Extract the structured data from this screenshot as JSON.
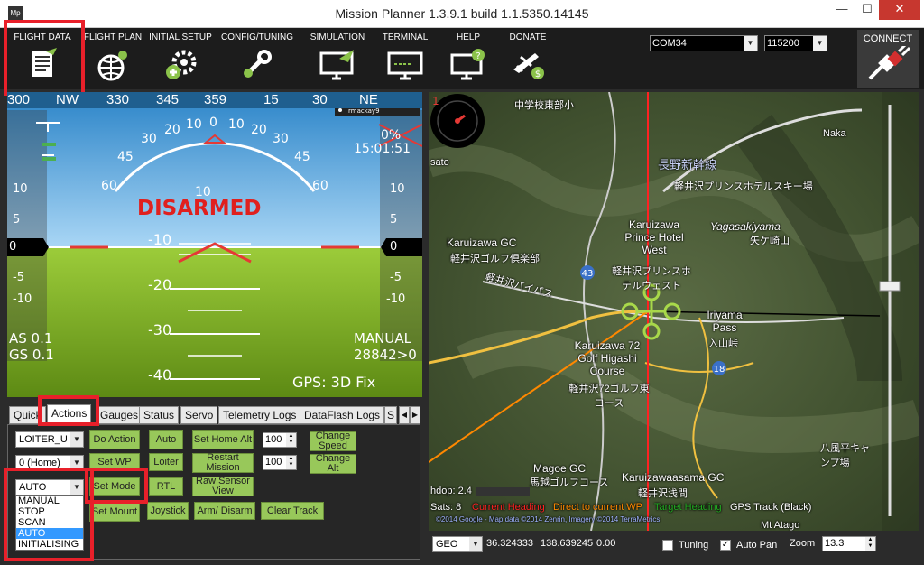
{
  "window": {
    "title": "Mission Planner 1.3.9.1 build 1.1.5350.14145",
    "icon": "Mp",
    "minimize": "—",
    "maximize": "☐",
    "close": "✕"
  },
  "toolbar": {
    "items": [
      {
        "label": "FLIGHT DATA",
        "icon": "flight-data-icon"
      },
      {
        "label": "FLIGHT PLAN",
        "icon": "flight-plan-icon"
      },
      {
        "label": "INITIAL SETUP",
        "icon": "initial-setup-icon"
      },
      {
        "label": "CONFIG/TUNING",
        "icon": "config-tuning-icon"
      },
      {
        "label": "SIMULATION",
        "icon": "simulation-icon"
      },
      {
        "label": "TERMINAL",
        "icon": "terminal-icon"
      },
      {
        "label": "HELP",
        "icon": "help-icon"
      },
      {
        "label": "DONATE",
        "icon": "donate-icon"
      }
    ],
    "port": "COM34",
    "baud": "115200",
    "connect_label": "CONNECT"
  },
  "hud": {
    "heading_ticks": [
      "300",
      "NW",
      "330",
      "345",
      "359",
      "15",
      "30",
      "NE"
    ],
    "pitch_labels": [
      "10",
      "-10",
      "-20",
      "-30",
      "-40"
    ],
    "roll_labels": [
      "60",
      "45",
      "30",
      "20",
      "10",
      "0",
      "10",
      "20",
      "30",
      "45",
      "60"
    ],
    "left_scale": [
      "10",
      "5",
      "0",
      "-5",
      "-10"
    ],
    "right_scale": [
      "10",
      "5",
      "0",
      "-5",
      "-10"
    ],
    "status": "DISARMED",
    "battery": "0%",
    "time": "15:01:51",
    "airspeed": "AS 0.1",
    "groundspeed": "GS 0.1",
    "mode": "MANUAL",
    "wp_info": "28842>0",
    "gps": "GPS: 3D Fix",
    "mini_label": "rmackay9"
  },
  "tabs": [
    "Quick",
    "Actions",
    "Gauges",
    "Status",
    "Servo",
    "Telemetry Logs",
    "DataFlash Logs",
    "S"
  ],
  "actions": {
    "mode_select": "LOITER_U",
    "wp_select": "0 (Home)",
    "setmode_select": "AUTO",
    "buttons": {
      "do_action": "Do Action",
      "auto": "Auto",
      "set_home_alt": "Set Home Alt",
      "set_wp": "Set WP",
      "loiter": "Loiter",
      "restart_mission": "Restart Mission",
      "set_mode": "Set Mode",
      "rtl": "RTL",
      "raw_sensor_view": "Raw Sensor View",
      "set_mount": "Set Mount",
      "joystick": "Joystick",
      "arm_disarm": "Arm/ Disarm",
      "clear_track": "Clear Track",
      "change_speed": "Change Speed",
      "change_alt": "Change Alt"
    },
    "speed_value": "100",
    "alt_value": "100",
    "dropdown_options": [
      "MANUAL",
      "STOP",
      "SCAN",
      "AUTO",
      "INITIALISING"
    ],
    "dropdown_selected": "AUTO"
  },
  "map": {
    "labels": {
      "nakaba": "Naka",
      "karuizawa_gc": "Karuizawa GC",
      "karuizawa_gc_jp": "軽井沢ゴルフ倶楽部",
      "prince_hotel": "Karuizawa Prince Hotel West",
      "prince_jp": "軽井沢プリンスホテルウェスト",
      "yagasaki": "Yagasakiyama",
      "yagasaki_jp": "矢ケ崎山",
      "iriyama": "Iriyama Pass",
      "iriyama_jp": "入山峠",
      "k72": "Karuizawa 72 Golf Higashi Course",
      "k72_jp": "軽井沢72ゴルフ東コース",
      "magoe": "Magoe GC",
      "magoe_jp": "馬越ゴルフコース",
      "waasama": "Karuizawaasama GC",
      "waasama_jp": "軽井沢浅間",
      "prince_ski": "軽井沢プリンスホテルスキー場",
      "hachimanpei": "八風平キャンプ場",
      "atago": "Mt Atago",
      "chu_school": "中学校東部小",
      "sato": "sato",
      "route43": "43",
      "route18": "18",
      "shinkansen": "長野新幹線",
      "bypass": "軽井沢バイパス"
    },
    "hdop": "hdop: 2.4",
    "sats": "Sats: 8",
    "legend": [
      "Current Heading",
      "Direct to current WP",
      "Target Heading",
      "GPS Track (Black)"
    ],
    "legend_colors": [
      "#ff2222",
      "#ff8800",
      "#22aa22",
      "#ffffff"
    ],
    "copyright": "©2014 Google - Map data ©2014 Zenrin, Imagery ©2014 TerraMetrics",
    "coord_system": "GEO",
    "lat": "36.324333",
    "lng": "138.639245",
    "alt": "0.00",
    "tuning_label": "Tuning",
    "autopan_label": "Auto Pan",
    "zoom_label": "Zoom",
    "zoom_value": "13.3",
    "number_1": "1"
  }
}
